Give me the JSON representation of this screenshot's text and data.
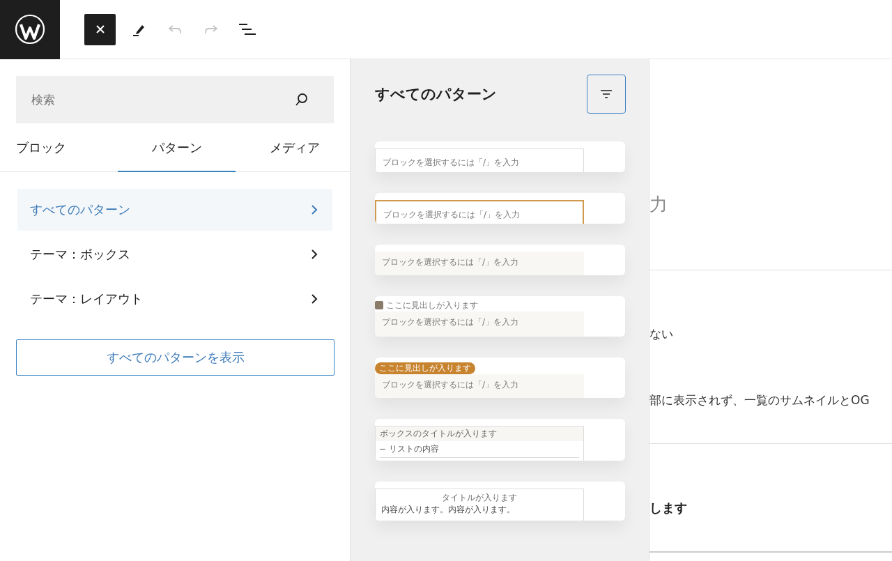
{
  "toolbar": {
    "tools": [
      {
        "kind": "close",
        "disabled": false
      },
      {
        "kind": "pen",
        "disabled": false
      },
      {
        "kind": "undo",
        "disabled": true
      },
      {
        "kind": "redo",
        "disabled": true
      },
      {
        "kind": "list",
        "disabled": false
      }
    ]
  },
  "inserter": {
    "search": {
      "placeholder": "検索"
    },
    "tabs": [
      {
        "label": "ブロック",
        "selected": false
      },
      {
        "label": "パターン",
        "selected": true
      },
      {
        "label": "メディア",
        "selected": false
      }
    ],
    "categories": [
      {
        "label": "すべてのパターン",
        "selected": true
      },
      {
        "label": "テーマ：ボックス",
        "selected": false
      },
      {
        "label": "テーマ：レイアウト",
        "selected": false
      }
    ],
    "show_all_button": "すべてのパターンを表示"
  },
  "patterns_panel": {
    "title": "すべてのパターン",
    "patterns": [
      {
        "kind": "plain",
        "text": "ブロックを選択するには「/」を入力"
      },
      {
        "kind": "accent-border",
        "text": "ブロックを選択するには「/」を入力"
      },
      {
        "kind": "tinted",
        "text": "ブロックを選択するには「/」を入力"
      },
      {
        "kind": "icon-heading",
        "heading": "ここに見出しが入ります",
        "text": "ブロックを選択するには「/」を入力"
      },
      {
        "kind": "pill-heading",
        "heading": "ここに見出しが入ります",
        "text": "ブロックを選択するには「/」を入力"
      },
      {
        "kind": "list-box",
        "heading": "ボックスのタイトルが入ります",
        "text": "リストの内容"
      },
      {
        "kind": "titled-box",
        "heading": "タイトルが入ります",
        "text": "内容が入ります。内容が入ります。"
      }
    ]
  },
  "editor": {
    "title_placeholder": "力",
    "sections": [
      {
        "lines": [
          {
            "kind": "text",
            "text": "ない"
          },
          {
            "kind": "text",
            "text": "部に表示されず、一覧のサムネイルとOG"
          }
        ]
      },
      {
        "lines": [
          {
            "kind": "strong",
            "text": "します"
          }
        ]
      }
    ]
  }
}
